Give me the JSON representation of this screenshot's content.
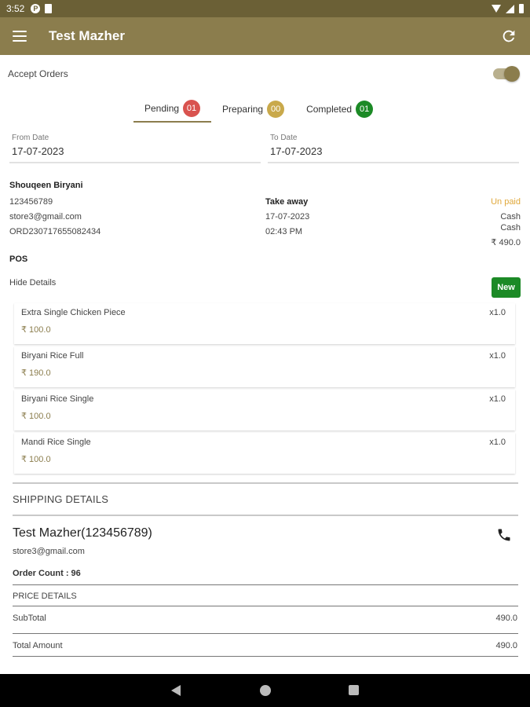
{
  "status_bar": {
    "time": "3:52",
    "icons": [
      "app-icon",
      "sd-card-icon",
      "wifi-icon",
      "signal-icon",
      "battery-icon"
    ]
  },
  "app_bar": {
    "title": "Test Mazher",
    "menu_icon": "hamburger-icon",
    "refresh_icon": "refresh-icon"
  },
  "accept_orders": {
    "label": "Accept Orders",
    "enabled": true
  },
  "tabs": [
    {
      "label": "Pending",
      "count": "01",
      "color": "#d9534f"
    },
    {
      "label": "Preparing",
      "count": "00",
      "color": "#c9a94b"
    },
    {
      "label": "Completed",
      "count": "01",
      "color": "#1c8a26"
    }
  ],
  "filters": {
    "from": {
      "label": "From Date",
      "value": "17-07-2023"
    },
    "to": {
      "label": "To Date",
      "value": "17-07-2023"
    }
  },
  "order": {
    "store": "Shouqeen Biryani",
    "phone": "123456789",
    "email": "store3@gmail.com",
    "order_id": "ORD230717655082434",
    "type": "Take away",
    "date": "17-07-2023",
    "time": "02:43 PM",
    "payment_status": "Un paid",
    "payment_method_1": "Cash",
    "payment_method_2": "Cash",
    "total": "₹ 490.0",
    "source": "POS",
    "hide_details": "Hide Details",
    "status_button": "New",
    "items": [
      {
        "name": "Extra Single Chicken Piece",
        "price": "₹ 100.0",
        "qty": "x1.0"
      },
      {
        "name": "Biryani Rice Full",
        "price": "₹ 190.0",
        "qty": "x1.0"
      },
      {
        "name": "Biryani Rice Single",
        "price": "₹ 100.0",
        "qty": "x1.0"
      },
      {
        "name": "Mandi Rice Single",
        "price": "₹ 100.0",
        "qty": "x1.0"
      }
    ]
  },
  "shipping": {
    "title": "SHIPPING DETAILS",
    "customer": "Test Mazher(123456789)",
    "email": "store3@gmail.com",
    "order_count": "Order Count : 96",
    "call_icon": "phone-icon"
  },
  "price_details": {
    "title": "PRICE DETAILS",
    "subtotal_label": "SubTotal",
    "subtotal_value": "490.0",
    "total_label": "Total Amount",
    "total_value": "490.0"
  },
  "nav_bar": {
    "back": "back-icon",
    "home": "home-icon",
    "recents": "recents-icon"
  },
  "colors": {
    "app_bar": "#8b7d4d",
    "status_bar": "#6b6036",
    "accent_green": "#1c8a26",
    "unpaid": "#e0a83b"
  }
}
